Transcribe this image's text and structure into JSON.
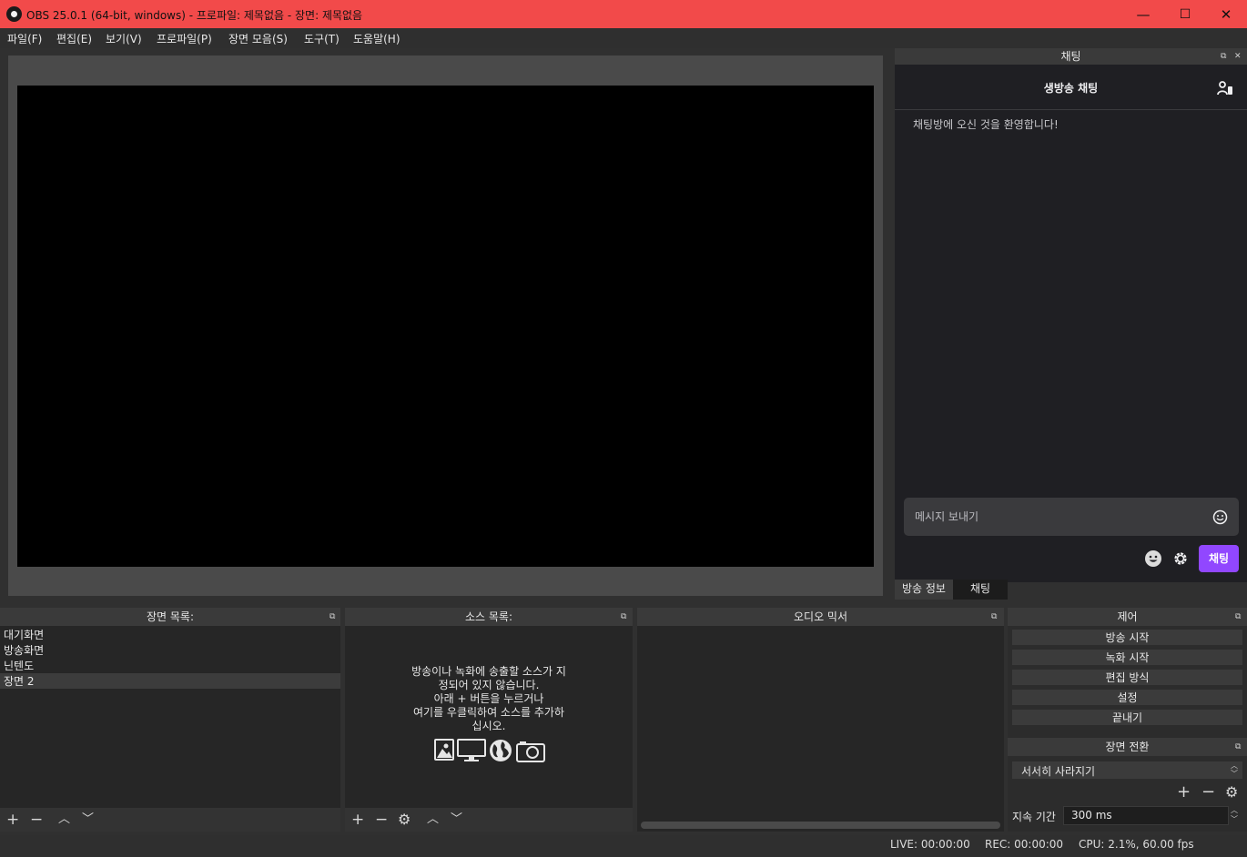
{
  "window": {
    "title": "OBS 25.0.1 (64-bit, windows) - 프로파일: 제목없음 - 장면: 제목없음",
    "minimize": "—",
    "maximize": "☐",
    "close": "✕",
    "titlebar_color": "#f24a4a"
  },
  "menu": [
    "파일(F)",
    "편집(E)",
    "보기(V)",
    "프로파일(P)",
    "장면 모음(S)",
    "도구(T)",
    "도움말(H)"
  ],
  "chat": {
    "dock_title": "채팅",
    "header_title": "생방송 채팅",
    "welcome": "채팅방에 오신 것을 환영합니다!",
    "input_placeholder": "메시지 보내기",
    "send_label": "채팅",
    "accent_color": "#9147ff",
    "icons": [
      "user-list-icon",
      "emoji-icon",
      "smiley-icon",
      "gear-icon"
    ]
  },
  "tabs": [
    "방송 정보",
    "채팅"
  ],
  "scenes": {
    "title": "장면 목록:",
    "items": [
      "대기화면",
      "방송화면",
      "닌텐도",
      "장면 2"
    ],
    "selected": "장면 2"
  },
  "sources": {
    "title": "소스 목록:",
    "empty_lines": [
      "방송이나 녹화에 송출할 소스가 지",
      "정되어 있지 않습니다.",
      "아래 + 버튼을 누르거나",
      "여기를 우클릭하여 소스를 추가하",
      "십시오."
    ],
    "icons": [
      "image-icon",
      "monitor-icon",
      "globe-icon",
      "camera-icon"
    ]
  },
  "mixer": {
    "title": "오디오 믹서"
  },
  "controls": {
    "title": "제어",
    "buttons": [
      "방송 시작",
      "녹화 시작",
      "편집 방식",
      "설정",
      "끝내기"
    ]
  },
  "transition": {
    "title": "장면 전환",
    "selected": "서서히 사라지기",
    "duration_label": "지속 기간",
    "duration_value": "300 ms"
  },
  "status": {
    "live": "LIVE: 00:00:00",
    "rec": "REC: 00:00:00",
    "cpu": "CPU: 2.1%, 60.00 fps"
  }
}
